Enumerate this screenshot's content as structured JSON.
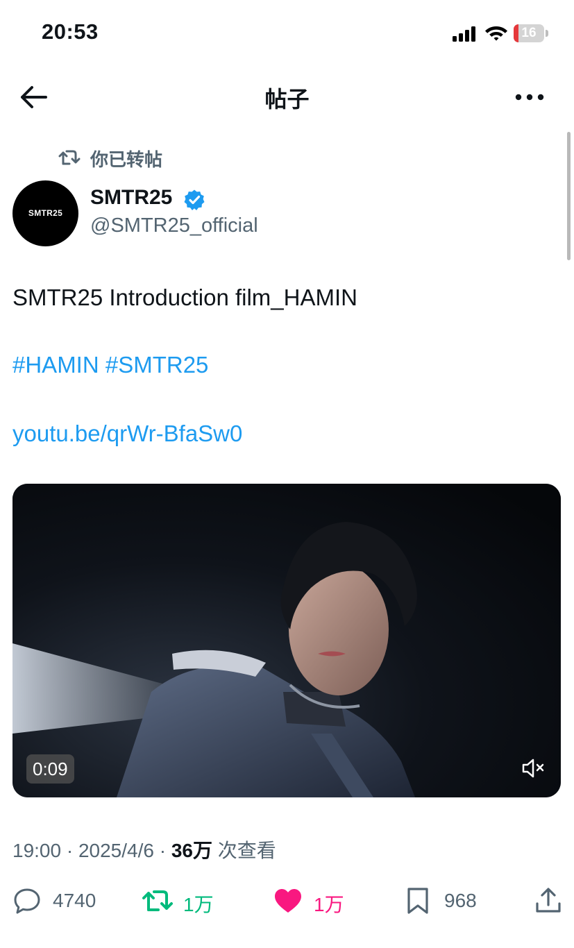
{
  "status_bar": {
    "time": "20:53",
    "battery_level": "16",
    "battery_fraction": 0.16
  },
  "header": {
    "title": "帖子",
    "back_icon": "arrow-left-icon",
    "more_icon": "ellipsis-icon"
  },
  "retweet_notice": {
    "text": "你已转帖",
    "icon": "retweet-icon"
  },
  "author": {
    "avatar_text": "SMTR25",
    "display_name": "SMTR25",
    "handle": "@SMTR25_official",
    "verified": true
  },
  "tweet": {
    "text": "SMTR25 Introduction film_HAMIN",
    "hashtags": [
      "#HAMIN",
      "#SMTR25"
    ],
    "link": "youtu.be/qrWr-BfaSw0"
  },
  "media": {
    "duration": "0:09",
    "muted": true
  },
  "meta": {
    "time": "19:00",
    "separator": "·",
    "date": "2025/4/6",
    "views_count": "36万",
    "views_label": "次查看"
  },
  "actions": {
    "reply_count": "4740",
    "retweet_count": "1万",
    "like_count": "1万",
    "bookmark_count": "968"
  },
  "colors": {
    "link": "#1d9bf0",
    "retweet_active": "#00ba7c",
    "like_active": "#f91880",
    "secondary_text": "#536471",
    "primary_text": "#0f1419"
  }
}
